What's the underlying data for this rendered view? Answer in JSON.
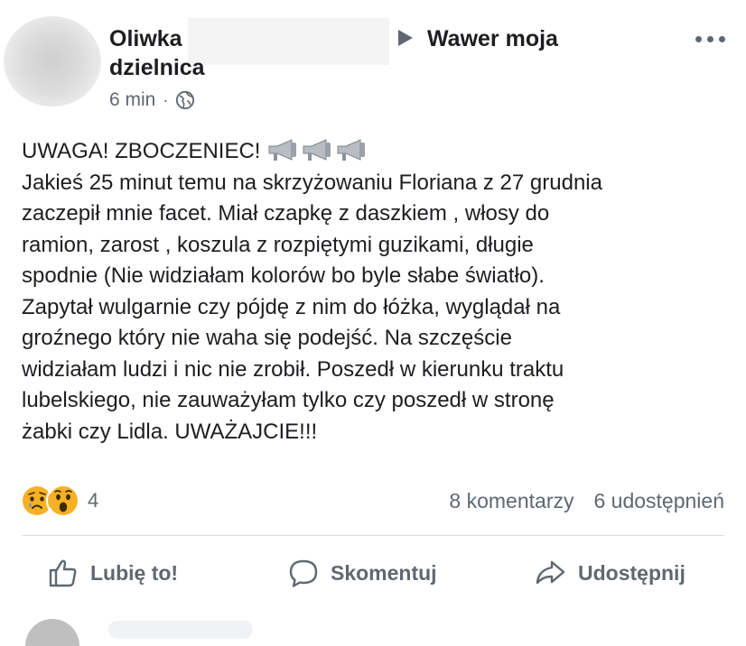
{
  "post": {
    "author_first": "Oliwka",
    "group_line1": "Wawer moja",
    "group_line2": "dzielnica",
    "time": "6 min",
    "dot": "·",
    "text": {
      "headline": "UWAGA! ZBOCZENIEC!",
      "lines": [
        "Jakieś 25 minut temu na skrzyżowaniu Floriana z 27 grudnia",
        "zaczepił mnie facet. Miał czapkę z daszkiem , włosy do",
        "ramion,  zarost , koszula z rozpiętymi guzikami,  długie",
        "spodnie (Nie widziałam kolorów bo byle słabe światło).",
        "Zapytał wulgarnie czy pójdę z nim do łóżka,  wyglądał na",
        "groźnego który nie waha się podejść. Na szczęście",
        "widziałam ludzi i nic nie zrobił. Poszedł w kierunku traktu",
        "lubelskiego,  nie zauważyłam tylko czy poszedł w stronę",
        "żabki czy Lidla. UWAŻAJCIE!!!"
      ]
    },
    "icons": {
      "more": "more-options-icon",
      "privacy": "globe-icon",
      "headline_emoji": "megaphone-icon",
      "reactions": [
        "sad-reaction-icon",
        "wow-reaction-icon"
      ]
    },
    "reaction_count": "4",
    "comments": "8 komentarzy",
    "shares": "6 udostępnień"
  },
  "actions": {
    "like": "Lubię to!",
    "comment": "Skomentuj",
    "share": "Udostępnij"
  },
  "colors": {
    "text": "#1c1e21",
    "secondary": "#606770",
    "divider": "#dadde1",
    "reaction_yellow": "#f7b125"
  }
}
